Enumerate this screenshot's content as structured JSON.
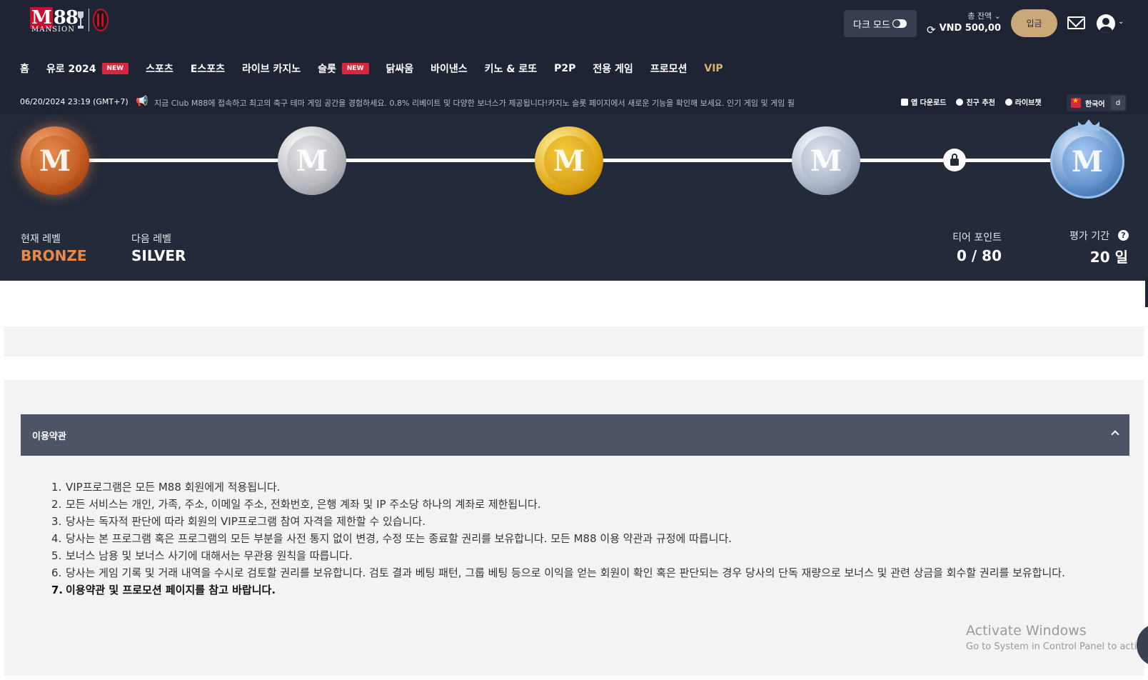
{
  "header": {
    "logo": {
      "brand": "M88",
      "sub": "MANSION"
    },
    "dark_mode_label": "다크 모드",
    "balance_label": "총 잔액",
    "balance_amount": "VND 500,00",
    "deposit_label": "입금"
  },
  "nav": [
    {
      "label": "홈",
      "badge": ""
    },
    {
      "label": "유로 2024",
      "badge": "NEW"
    },
    {
      "label": "스포츠",
      "badge": ""
    },
    {
      "label": "E스포츠",
      "badge": ""
    },
    {
      "label": "라이브 카지노",
      "badge": ""
    },
    {
      "label": "슬롯",
      "badge": "NEW"
    },
    {
      "label": "닭싸움",
      "badge": ""
    },
    {
      "label": "바이낸스",
      "badge": ""
    },
    {
      "label": "키노 & 로또",
      "badge": ""
    },
    {
      "label": "P2P",
      "badge": ""
    },
    {
      "label": "전용 게임",
      "badge": ""
    },
    {
      "label": "프로모션",
      "badge": ""
    },
    {
      "label": "VIP",
      "badge": ""
    }
  ],
  "ticker": {
    "datetime": "06/20/2024 23:19 (GMT+7)",
    "message": "지금 Club M88에 접속하고 최고의 축구 테마 게임 공간을 경험하세요. 0.8% 리베이트 및 다양한 보너스가 제공됩니다!카지노 슬롯 페이지에서 새로운 기능을 확인해 보세요. 인기 게임 및 게임 필",
    "app_download": "앱 다운로드",
    "refer_friend": "친구 추천",
    "live_chat": "라이브챗",
    "language": "한국어",
    "lang_extra": "d"
  },
  "vip": {
    "current_level_label": "현재 레벨",
    "current_level": "BRONZE",
    "next_level_label": "다음 레벨",
    "next_level": "SILVER",
    "tier_points_label": "티어 포인트",
    "tier_points": "0 / 80",
    "period_label": "평가 기간",
    "period_value": "20 일",
    "medal_glyph": "M",
    "colors": {
      "bronze": "#e8894c",
      "panel": "#232a39"
    }
  },
  "terms": {
    "title": "이용약관",
    "items": [
      "VIP프로그램은 모든 M88 회원에게 적용됩니다.",
      "모든 서비스는 개인, 가족, 주소, 이메일 주소, 전화번호, 은행 계좌 및 IP 주소당 하나의 계좌로 제한됩니다.",
      "당사는 독자적 판단에 따라 회원의 VIP프로그램 참여 자격을 제한할 수 있습니다.",
      "당사는 본 프로그램 혹은 프로그램의 모든 부분을 사전 통지 없이 변경, 수정 또는 종료할 권리를 보유합니다. 모든 M88 이용 약관과 규정에 따릅니다.",
      "보너스 남용 및 보너스 사기에 대해서는 무관용 원칙을 따릅니다.",
      "당사는 게임 기록 및 거래 내역을 수시로 검토할 권리를 보유합니다. 검토 결과 베팅 패턴, 그룹 베팅 등으로 이익을 얻는 회원이 확인 혹은 판단되는 경우 당사의 단독 재량으로 보너스 및 관련 상금을 회수할 권리를 보유합니다.",
      "이용약관 및 프로모션 페이지를 참고 바랍니다."
    ],
    "numbers": [
      "1.",
      "2.",
      "3.",
      "4.",
      "5.",
      "6.",
      "7."
    ]
  },
  "watermark": {
    "line1": "Activate Windows",
    "line2": "Go to System in Control Panel to activa"
  }
}
